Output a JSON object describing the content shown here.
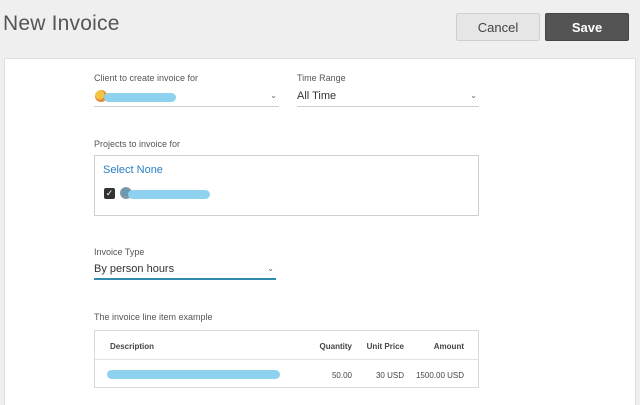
{
  "header": {
    "title": "New Invoice",
    "cancel_label": "Cancel",
    "save_label": "Save"
  },
  "client": {
    "label": "Client to create invoice for",
    "chevron": "⌄"
  },
  "time_range": {
    "label": "Time Range",
    "value": "All Time",
    "chevron": "⌄"
  },
  "projects": {
    "label": "Projects to invoice for",
    "select_none": "Select None",
    "checked_mark": "✓"
  },
  "invoice_type": {
    "label": "Invoice Type",
    "value": "By person hours",
    "chevron": "⌄",
    "accent": "#2f8ab0"
  },
  "line_item": {
    "label": "The invoice line item example",
    "columns": {
      "description": "Description",
      "quantity": "Quantity",
      "unit_price": "Unit Price",
      "amount": "Amount"
    },
    "row": {
      "quantity": "50.00",
      "unit_price": "30 USD",
      "amount": "1500.00 USD"
    }
  },
  "colors": {
    "link": "#2b7fc4",
    "redaction": "#8fd2f0",
    "save_bg": "#545454"
  }
}
